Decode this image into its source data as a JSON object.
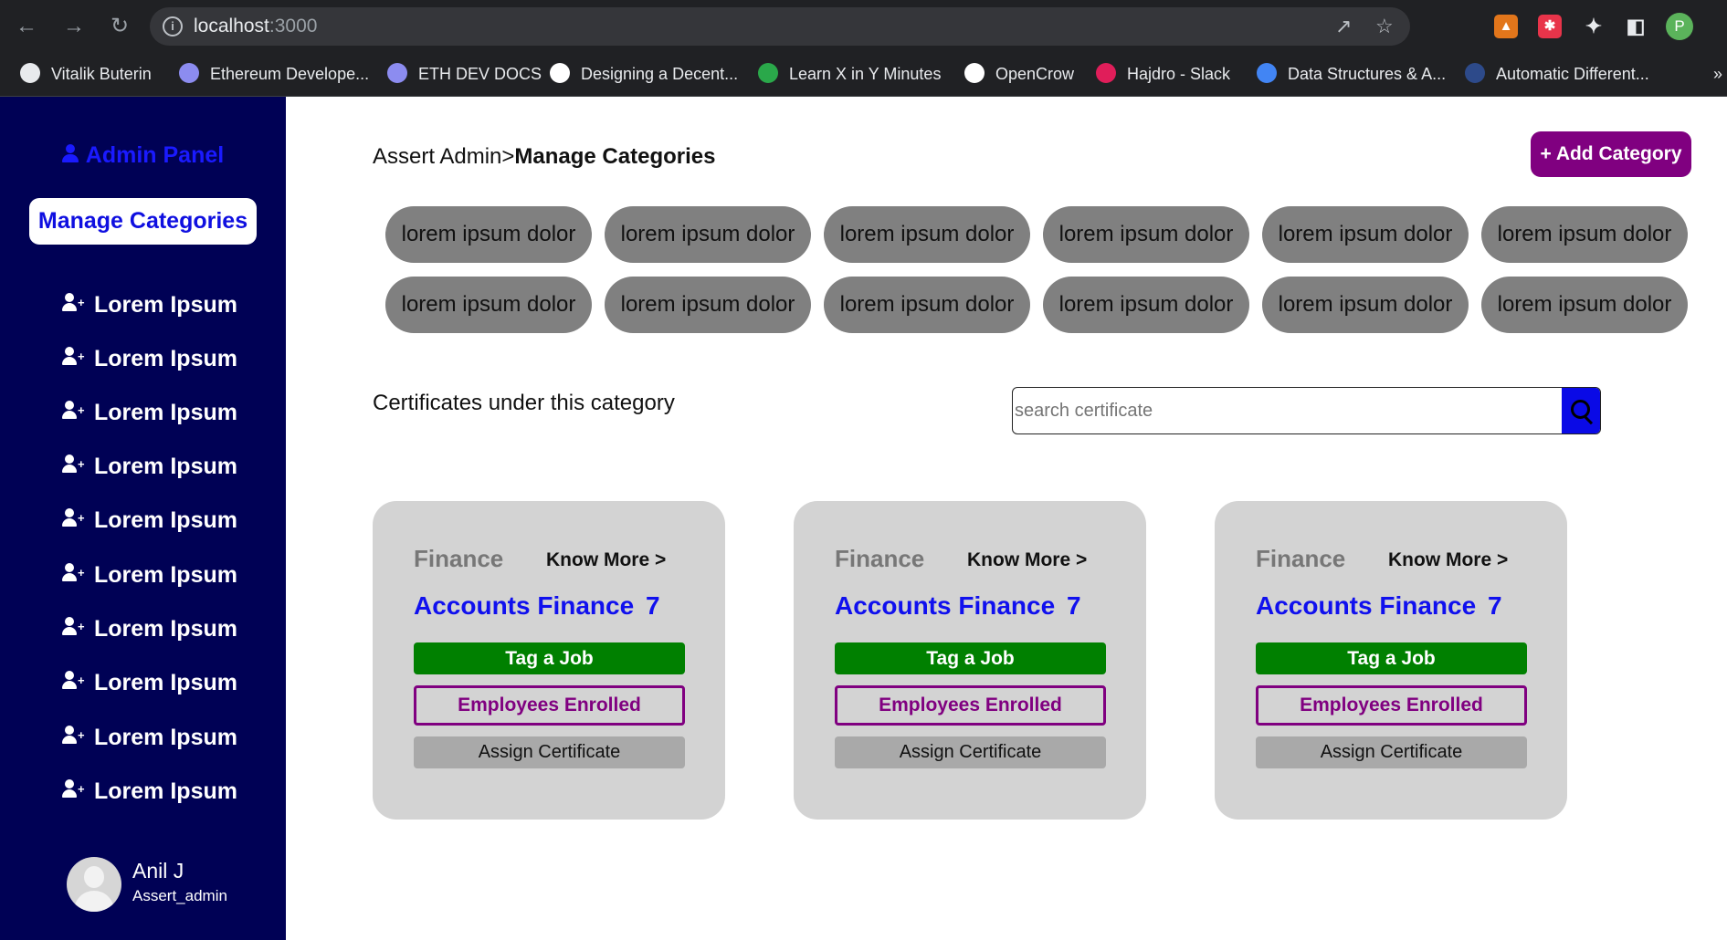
{
  "browser": {
    "url_host": "localhost",
    "url_port": ":3000",
    "profile_initial": "P",
    "bookmarks": [
      {
        "label": "Vitalik Buterin",
        "icon": "globe-icon",
        "color": "#e8eaed"
      },
      {
        "label": "Ethereum Develope...",
        "icon": "ethereum-icon",
        "color": "#8c8cf0"
      },
      {
        "label": "ETH DEV DOCS",
        "icon": "ethereum-icon",
        "color": "#8c8cf0"
      },
      {
        "label": "Designing a Decent...",
        "icon": "medium-icon",
        "color": "#ffffff"
      },
      {
        "label": "Learn X in Y Minutes",
        "icon": "learnx-icon",
        "color": "#2aa84a"
      },
      {
        "label": "OpenCrow",
        "icon": "github-icon",
        "color": "#ffffff"
      },
      {
        "label": "Hajdro - Slack",
        "icon": "slack-icon",
        "color": "#e01e5a"
      },
      {
        "label": "Data Structures & A...",
        "icon": "google-icon",
        "color": "#4285f4"
      },
      {
        "label": "Automatic Different...",
        "icon": "tds-icon",
        "color": "#2d4a8a"
      }
    ],
    "more_bookmarks": "»"
  },
  "sidebar": {
    "title": "Admin Panel",
    "active_item": "Manage Categories",
    "items": [
      "Lorem Ipsum",
      "Lorem Ipsum",
      "Lorem Ipsum",
      "Lorem Ipsum",
      "Lorem Ipsum",
      "Lorem Ipsum",
      "Lorem Ipsum",
      "Lorem Ipsum",
      "Lorem Ipsum",
      "Lorem Ipsum"
    ],
    "user": {
      "name": "Anil J",
      "role": "Assert_admin"
    }
  },
  "main": {
    "breadcrumb_parent": "Assert Admin>",
    "breadcrumb_current": "Manage Categories",
    "add_button": "+ Add Category",
    "chips": [
      "lorem ipsum dolor",
      "lorem ipsum dolor",
      "lorem ipsum dolor",
      "lorem ipsum dolor",
      "lorem ipsum dolor",
      "lorem ipsum dolor",
      "lorem ipsum dolor",
      "lorem ipsum dolor",
      "lorem ipsum dolor",
      "lorem ipsum dolor",
      "lorem ipsum dolor",
      "lorem ipsum dolor"
    ],
    "certificates_label": "Certificates under this category",
    "search": {
      "placeholder": "search certificate",
      "value": ""
    },
    "cards": [
      {
        "category": "Finance",
        "know_more": "Know More >",
        "title": "Accounts Finance",
        "count": "7",
        "tag_job": "Tag a Job",
        "employees": "Employees Enrolled",
        "assign": "Assign Certificate"
      },
      {
        "category": "Finance",
        "know_more": "Know More >",
        "title": "Accounts Finance",
        "count": "7",
        "tag_job": "Tag a Job",
        "employees": "Employees Enrolled",
        "assign": "Assign Certificate"
      },
      {
        "category": "Finance",
        "know_more": "Know More >",
        "title": "Accounts Finance",
        "count": "7",
        "tag_job": "Tag a Job",
        "employees": "Employees Enrolled",
        "assign": "Assign Certificate"
      }
    ]
  },
  "colors": {
    "sidebar_bg": "#000155",
    "accent_purple": "#800080",
    "accent_blue": "#1010ee",
    "tag_green": "#008000",
    "chip_gray": "#808080",
    "card_gray": "#d3d3d3"
  }
}
